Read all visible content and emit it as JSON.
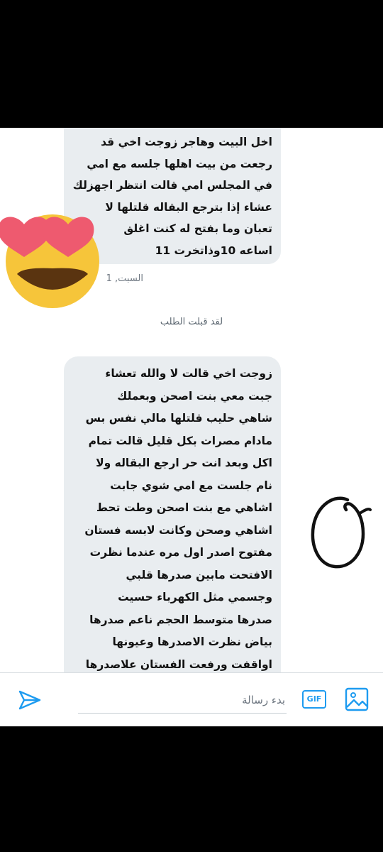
{
  "conversation": {
    "message_1": {
      "text": "اخل البيت   وهاجر زوجت اخي قد\nرجعت من بيت اهلها  جلسه مع امي\nفي المجلس امي قالت انتظر اجهزلك\nعشاء إذا بترجع البقاله قلتلها لا\nتعبان وما بفتح له كنت اغلق\nاساعه 10وذاتخرت 11",
      "timestamp": "السبت, 1"
    },
    "system_notice": "لقد قبلت الطلب",
    "message_2": {
      "text": "زوجت اخي قالت لا والله تعشاء\nجبت معي بنت اصحن وبعملك\nشاهي حليب قلتلها مالي نفس بس\nمادام مصرات بكل قليل قالت تمام\nاكل وبعد انت حر ارجع البقاله ولا\nنام جلست مع امي شوي جابت\nاشاهي مع بنت اصحن وطت تحط\nاشاهي وصحن وكانت لابسه فستان\nمفتوح اصدر اول مره عندما نظرت\nالافتحت مابين صدرها  قلبي\nوجسمي مثل الكهرباء حسيت\nصدرها متوسط الحجم ناعم صدرها\nبياض نظرت الاصدرها وعيونها\nاواقفت ورفعت الفستان علاصدرها\nوذهبت جلست مع امي مقابل الي"
    }
  },
  "stickers": {
    "emoji": "heart-eyes-emoji",
    "drawn_symbol": "0"
  },
  "composer": {
    "placeholder": "بدء رسالة",
    "gif_label": "GIF",
    "send_icon": "send-icon",
    "media_icon": "image-icon"
  },
  "colors": {
    "accent": "#1d9bf0",
    "bubble": "#e9edf0",
    "emoji_face": "#f6c53a",
    "emoji_hearts": "#ee5a6f"
  }
}
